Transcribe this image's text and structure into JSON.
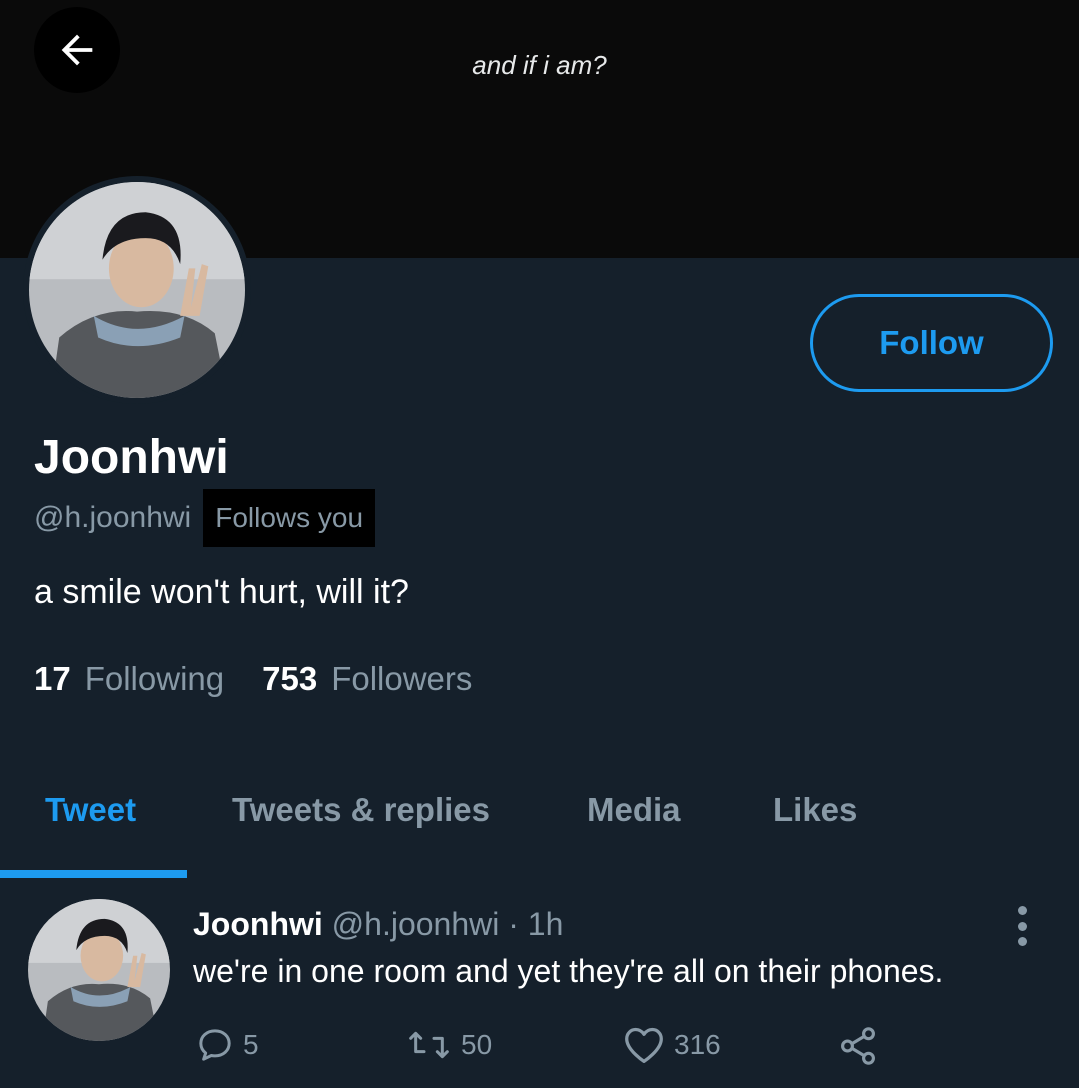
{
  "header": {
    "back_icon": "arrow-left-icon",
    "banner_text": "and if i am?"
  },
  "profile": {
    "display_name": "Joonhwi",
    "handle": "@h.joonhwi",
    "follows_you": "Follows you",
    "bio": "a smile won't hurt, will it?",
    "following_count": "17",
    "following_label": "Following",
    "followers_count": "753",
    "followers_label": "Followers",
    "follow_button": "Follow"
  },
  "tabs": [
    {
      "label": "Tweet",
      "active": true
    },
    {
      "label": "Tweets & replies",
      "active": false
    },
    {
      "label": "Media",
      "active": false
    },
    {
      "label": "Likes",
      "active": false
    }
  ],
  "tweet": {
    "name": "Joonhwi",
    "meta": " @h.joonhwi · 1h",
    "text": "we're in one room and yet they're all on their phones.",
    "replies": "5",
    "retweets": "50",
    "likes": "316",
    "icons": {
      "reply": "reply-icon",
      "retweet": "retweet-icon",
      "like": "heart-icon",
      "share": "share-icon",
      "more": "more-vertical-icon"
    }
  },
  "colors": {
    "accent": "#1d9bf0",
    "background": "#15202b",
    "banner": "#0a0a0a",
    "muted": "#8899a6"
  }
}
